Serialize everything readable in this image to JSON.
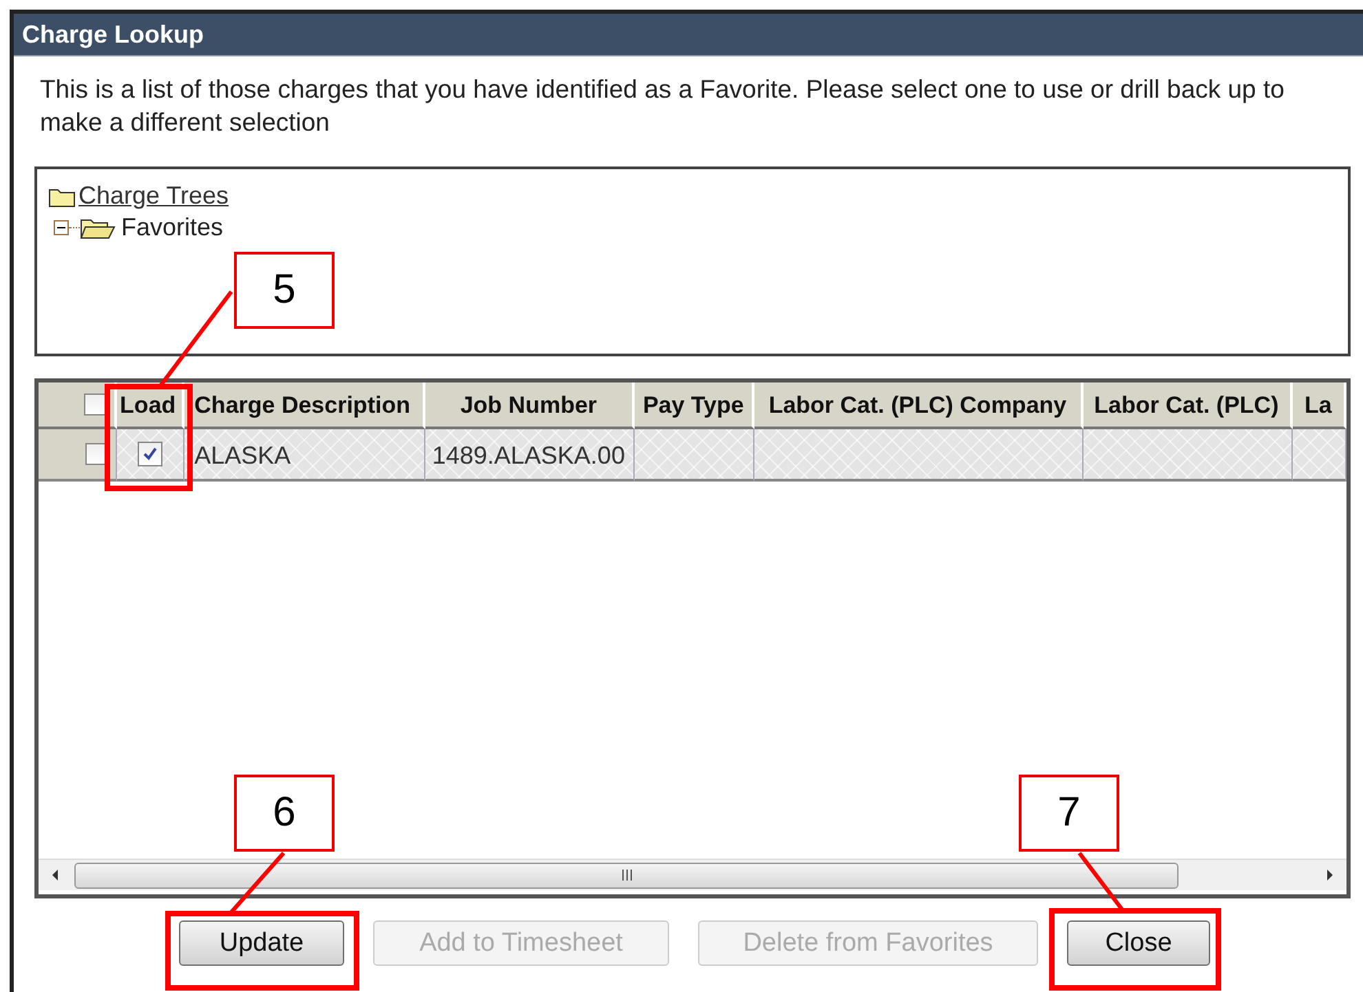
{
  "window": {
    "title": "Charge Lookup"
  },
  "instructions": "This is a list of those charges that you have identified as a Favorite. Please select one to use or drill back up to make a different selection",
  "tree": {
    "label": "Charge Trees",
    "children": [
      {
        "label": "Favorites",
        "expanded": true
      }
    ]
  },
  "grid": {
    "select_all": {
      "checked": false
    },
    "columns": [
      "Load",
      "Charge Description",
      "Job Number",
      "Pay Type",
      "Labor Cat. (PLC) Company",
      "Labor Cat. (PLC)",
      "La"
    ],
    "rows": [
      {
        "selected": false,
        "load": true,
        "cells": [
          "",
          "ALASKA",
          "1489.ALASKA.00"
        ]
      }
    ]
  },
  "buttons": [
    {
      "label": "Update",
      "disabled": false
    },
    {
      "label": "Add to Timesheet",
      "disabled": true
    },
    {
      "label": "Delete from Favorites",
      "disabled": true
    },
    {
      "label": "Close",
      "disabled": false
    }
  ],
  "callouts": [
    {
      "label": "5"
    },
    {
      "label": "6"
    },
    {
      "label": "7"
    }
  ]
}
